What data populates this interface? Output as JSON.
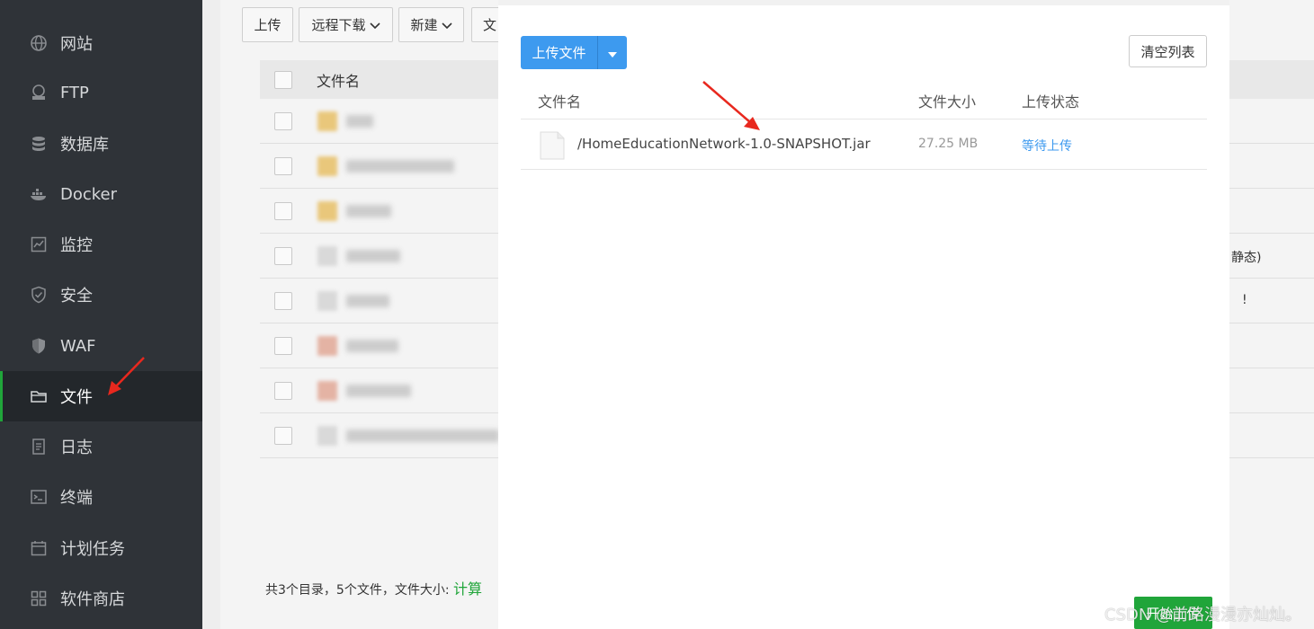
{
  "sidebar": {
    "items": [
      {
        "label": "网站",
        "icon": "globe-icon"
      },
      {
        "label": "FTP",
        "icon": "ftp-icon"
      },
      {
        "label": "数据库",
        "icon": "database-icon"
      },
      {
        "label": "Docker",
        "icon": "docker-icon"
      },
      {
        "label": "监控",
        "icon": "monitor-icon"
      },
      {
        "label": "安全",
        "icon": "shield-icon"
      },
      {
        "label": "WAF",
        "icon": "waf-shield-icon"
      },
      {
        "label": "文件",
        "icon": "folder-icon",
        "active": true
      },
      {
        "label": "日志",
        "icon": "log-icon"
      },
      {
        "label": "终端",
        "icon": "terminal-icon"
      },
      {
        "label": "计划任务",
        "icon": "calendar-icon"
      },
      {
        "label": "软件商店",
        "icon": "apps-grid-icon"
      }
    ]
  },
  "toolbar": {
    "upload": "上传",
    "remote_download": "远程下载",
    "new": "新建",
    "truncated": "文"
  },
  "file_table": {
    "header_name": "文件名",
    "right_snippets": [
      "静态)",
      "!"
    ],
    "summary_prefix": "共3个目录，5个文件，文件大小: ",
    "summary_calc": "计算"
  },
  "modal": {
    "upload_file_button": "上传文件",
    "clear_list_button": "清空列表",
    "columns": {
      "name": "文件名",
      "size": "文件大小",
      "status": "上传状态"
    },
    "files": [
      {
        "name": "/HomeEducationNetwork-1.0-SNAPSHOT.jar",
        "size": "27.25 MB",
        "status": "等待上传"
      }
    ],
    "start_upload_button": "开始上传"
  },
  "watermark": "CSDN @前路漫漫亦灿灿。",
  "colors": {
    "accent_green": "#20a53a",
    "primary_blue": "#3d9aef",
    "arrow_red": "#e8281e",
    "sidebar_bg": "#2f3338"
  }
}
